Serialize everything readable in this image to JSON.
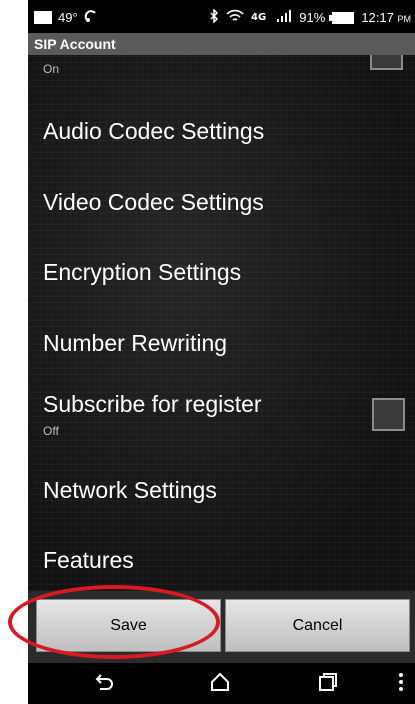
{
  "status": {
    "temperature": "49°",
    "battery": "91%",
    "time": "12:17",
    "ampm": "PM",
    "icons": [
      "message-icon",
      "hotspot-icon",
      "bluetooth-icon",
      "wifi-icon",
      "4g-lte-icon",
      "signal-icon",
      "battery-icon"
    ]
  },
  "title": "SIP Account",
  "settings": {
    "prev_sub": "On",
    "audio": "Audio Codec Settings",
    "video": "Video Codec Settings",
    "encryption": "Encryption Settings",
    "number": "Number Rewriting",
    "subscribe": "Subscribe for register",
    "subscribe_sub": "Off",
    "network": "Network Settings",
    "features": "Features"
  },
  "buttons": {
    "save": "Save",
    "cancel": "Cancel"
  },
  "nav": {
    "back": "back-icon",
    "home": "home-icon",
    "recents": "recents-icon",
    "menu": "menu-icon"
  },
  "colors": {
    "highlight": "#d91a22",
    "titlebar": "#5a5a5a"
  }
}
